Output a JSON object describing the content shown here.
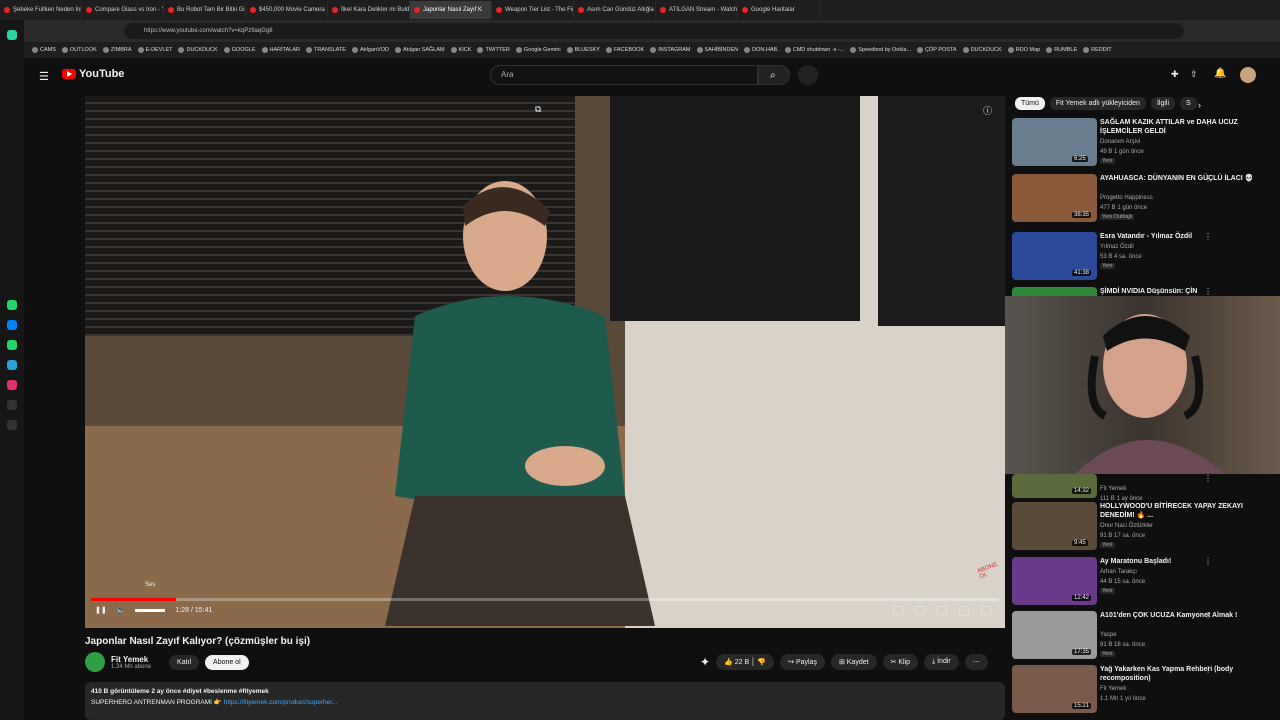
{
  "browser": {
    "tabs": [
      "Şebeke Fullken Neden İni",
      "Compare Glass vs Iron - Y",
      "Bu Robot Tam Bir Bitki Gi",
      "$450,000 Movie Camera",
      "İlkel Kara Delikler mi Buld",
      "Japonlar Nasıl Zayıf K",
      "Weapon Tier List - The Fin",
      "Asım Can Gündüz Allığla",
      "ATILGAN Stream - Watch",
      "Google Haritalar"
    ],
    "url": "https://www.youtube.com/watch?v=kqPz9aqGg8",
    "bookmarks": [
      "CAMS",
      "OUTLOOK",
      "ZIMBRA",
      "E-DEVLET",
      "DUCKDUCK",
      "GOOGLE",
      "HARİTALAR",
      "TRANSLATE",
      "AtılganVOD",
      "Atılgan SAĞLAM",
      "KICK",
      "TWITTER",
      "Google Gemini",
      "BLUESKY",
      "FACEBOOK",
      "INSTAGRAM",
      "SAHİBİNDEN",
      "DON.HAB.",
      "CMD shutdown -s -...",
      "Speedtest by Ookla...",
      "ÇÖP POSTA",
      "DUCKDUCK",
      "RDO Map",
      "RUMBLE",
      "REDDIT"
    ]
  },
  "yt": {
    "logo": "YouTube",
    "search_placeholder": "Ara"
  },
  "player": {
    "time": "1:28 / 15:41",
    "volume_label": "Ses",
    "progress": 0.094,
    "watermark": "ABONE OL"
  },
  "video": {
    "title": "Japonlar Nasıl Zayıf Kalıyor? (çözmüşler bu işi)",
    "channel": "Fit Yemek",
    "subs": "1,34 Mn abone",
    "join": "Katıl",
    "subscribe": "Abone ol",
    "likes": "22 B",
    "share": "Paylaş",
    "save": "Kaydet",
    "clip": "Klip",
    "download": "İndir"
  },
  "description": {
    "line1": "410 B görüntüleme  2 ay önce  #diyet #beslenme #fityemek",
    "line2": "SUPERHERO ANTRENMAN PROGRAMI 👉 ",
    "link": "https://fityemek.com/product/superher..."
  },
  "chips": [
    "Tümü",
    "Fit Yemek adlı yükleyiciden",
    "İlgili",
    "S"
  ],
  "recs": [
    {
      "title": "SAĞLAM KAZIK ATTILAR ve DAHA UCUZ İŞLEMCİLER GELDİ",
      "channel": "Donanım Arşivi",
      "meta": "49 B  1 gün önce",
      "badge": "Yeni",
      "dur": "6:25"
    },
    {
      "title": "AYAHUASCA: DÜNYANIN EN GÜÇLÜ İLACI 💀",
      "channel": "Progetto Happiness",
      "meta": "477 B  1 gün önce",
      "badge": "Yeni  Dublajlı",
      "dur": "38:35"
    },
    {
      "title": "Esra Vatandır - Yılmaz Özdil",
      "channel": "Yılmaz Özdil",
      "meta": "53 B  4 sa. önce",
      "badge": "Yeni",
      "dur": "41:38"
    },
    {
      "title": "ŞİMDİ NVIDIA Düşünsün: ÇİN",
      "channel": "",
      "meta": "",
      "badge": "",
      "dur": ""
    },
    {
      "title": "",
      "channel": "Fit Yemek",
      "meta": "111 B  1 ay önce",
      "badge": "",
      "dur": "14:32"
    },
    {
      "title": "HOLLYWOOD'U BİTİRECEK YAPAY ZEKAYI DENEDİM! 🔥 ...",
      "channel": "Onur Naci Öztürkler",
      "meta": "91 B  17 sa. önce",
      "badge": "Yeni",
      "dur": "9:45"
    },
    {
      "title": "Ay Maratonu Başladı!",
      "channel": "Arhan Tarakçı",
      "meta": "44 B  15 sa. önce",
      "badge": "Yeni",
      "dur": "12:42"
    },
    {
      "title": "A101'den ÇOK UCUZA Kamyonet Almak !",
      "channel": "Yaspe",
      "meta": "91 B  18 sa. önce",
      "badge": "Yeni",
      "dur": "17:35"
    },
    {
      "title": "Yağ Yakarken Kas Yapma Rehberi (body recomposition)",
      "channel": "Fit Yemek",
      "meta": "1,1 Mn  1 yıl önce",
      "badge": "",
      "dur": "15:21"
    }
  ]
}
